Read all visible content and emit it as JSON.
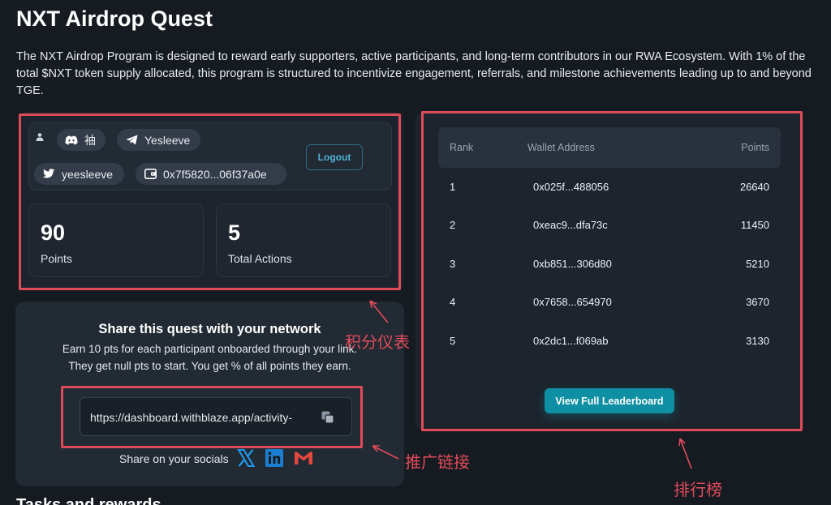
{
  "page": {
    "title": "NXT Airdrop Quest",
    "intro": "The NXT Airdrop Program is designed to reward early supporters, active participants, and long-term contributors in our RWA Ecosystem. With 1% of the total $NXT token supply allocated, this program is structured to incentivize engagement, referrals, and milestone achievements leading up to and beyond TGE.",
    "next_section_title": "Tasks and rewards"
  },
  "profile": {
    "discord_name": "袖",
    "telegram_name": "Yesleeve",
    "twitter_name": "yeesleeve",
    "wallet_short": "0x7f5820...06f37a0e",
    "logout_label": "Logout"
  },
  "stats": {
    "points_value": "90",
    "points_label": "Points",
    "actions_value": "5",
    "actions_label": "Total Actions"
  },
  "share": {
    "title": "Share this quest with your network",
    "desc_line1": "Earn 10 pts for each participant onboarded through your link.",
    "desc_line2": "They get null pts to start.  You get % of all points they earn.",
    "link_value": "https://dashboard.withblaze.app/activity-",
    "socials_label": "Share on your socials"
  },
  "leaderboard": {
    "columns": {
      "rank": "Rank",
      "wallet": "Wallet Address",
      "points": "Points"
    },
    "rows": [
      {
        "rank": "1",
        "wallet": "0x025f...488056",
        "points": "26640"
      },
      {
        "rank": "2",
        "wallet": "0xeac9...dfa73c",
        "points": "11450"
      },
      {
        "rank": "3",
        "wallet": "0xb851...306d80",
        "points": "5210"
      },
      {
        "rank": "4",
        "wallet": "0x7658...654970",
        "points": "3670"
      },
      {
        "rank": "5",
        "wallet": "0x2dc1...f069ab",
        "points": "3130"
      }
    ],
    "button_label": "View Full Leaderboard"
  },
  "annotations": {
    "dashboard": "积分仪表",
    "referral_link": "推广链接",
    "leaderboard": "排行榜"
  },
  "colors": {
    "background": "#161b22",
    "panel": "#1d242d",
    "accent": "#0f8fa3",
    "annotation": "#e04b5a"
  }
}
